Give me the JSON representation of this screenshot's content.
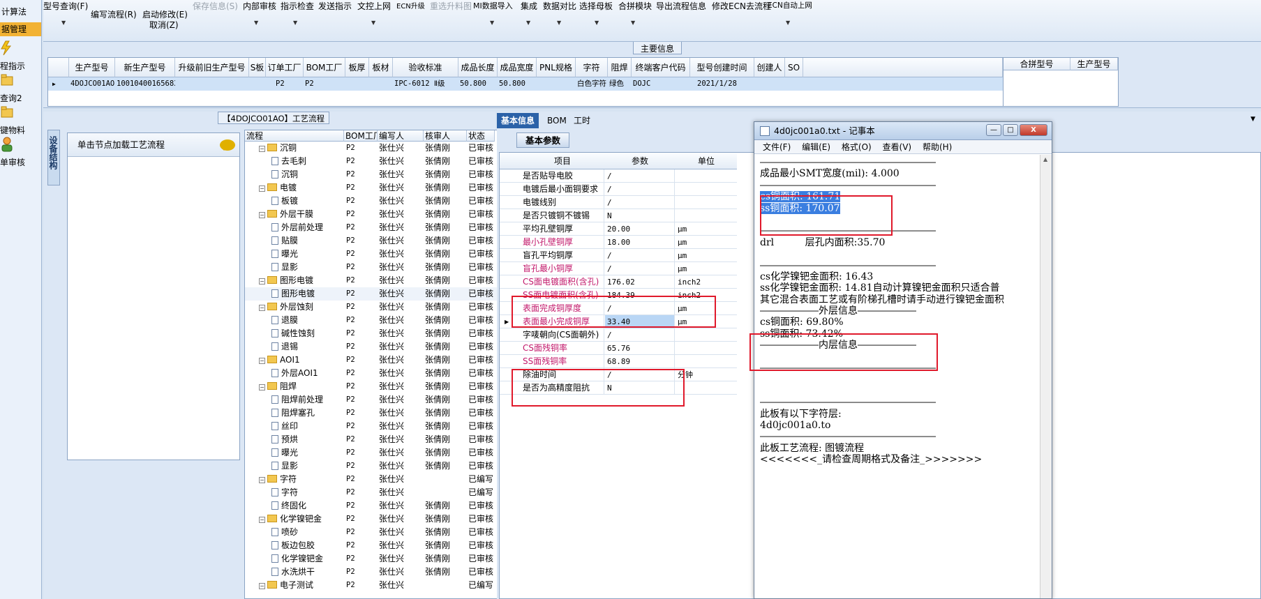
{
  "nav": {
    "items": [
      "计算法",
      "据管理",
      "程指示",
      "查询2",
      "键物料",
      "单审核"
    ]
  },
  "toolbar": {
    "row1": [
      "型号查询(F)",
      "保存信息(S)",
      "内部审核",
      "指示检查",
      "发送指示",
      "文控上网",
      "ECN升级",
      "重选升料图",
      "MI数据导入",
      "集成",
      "数据对比",
      "选择母板",
      "合拼模块",
      "导出流程信息",
      "修改ECN去流程",
      "ECN自动上网"
    ],
    "row2": [
      "编写流程(R)",
      "启动修改(E)"
    ],
    "row3": [
      "取消(Z)"
    ]
  },
  "main": {
    "title": "主要信息",
    "headers": [
      "生产型号",
      "新生产型号",
      "升级前旧生产型号",
      "S板",
      "订单工厂",
      "BOM工厂",
      "板厚",
      "板材",
      "验收标准",
      "成品长度",
      "成品宽度",
      "PNL规格",
      "字符",
      "阻焊",
      "终端客户代码",
      "型号创建时间",
      "创建人",
      "SO"
    ],
    "row": [
      "4DOJCO01AO",
      "10010400165683",
      "",
      "",
      "P2",
      "P2",
      "",
      "",
      "IPC-6012 Ⅱ级",
      "50.800",
      "50.800",
      "",
      "白色字符",
      "绿色",
      "DOJC",
      "2021/1/28",
      "",
      ""
    ],
    "right_headers": [
      "合拼型号",
      "生产型号"
    ]
  },
  "process": {
    "title": "【4DOJCO01AO】工艺流程",
    "side_tab": "设备结构",
    "load_text": "单击节点加载工艺流程",
    "headers": [
      "流程",
      "BOM工厂",
      "编写人",
      "核审人",
      "状态"
    ],
    "rows": [
      {
        "level": 1,
        "name": "沉铜",
        "factory": "P2",
        "writer": "张仕兴",
        "reviewer": "张倩刚",
        "status": "已审核"
      },
      {
        "level": 2,
        "name": "去毛刺",
        "factory": "P2",
        "writer": "张仕兴",
        "reviewer": "张倩刚",
        "status": "已审核"
      },
      {
        "level": 2,
        "name": "沉铜",
        "factory": "P2",
        "writer": "张仕兴",
        "reviewer": "张倩刚",
        "status": "已审核"
      },
      {
        "level": 1,
        "name": "电镀",
        "factory": "P2",
        "writer": "张仕兴",
        "reviewer": "张倩刚",
        "status": "已审核"
      },
      {
        "level": 2,
        "name": "板镀",
        "factory": "P2",
        "writer": "张仕兴",
        "reviewer": "张倩刚",
        "status": "已审核"
      },
      {
        "level": 1,
        "name": "外层干膜",
        "factory": "P2",
        "writer": "张仕兴",
        "reviewer": "张倩刚",
        "status": "已审核"
      },
      {
        "level": 2,
        "name": "外层前处理",
        "factory": "P2",
        "writer": "张仕兴",
        "reviewer": "张倩刚",
        "status": "已审核"
      },
      {
        "level": 2,
        "name": "贴膜",
        "factory": "P2",
        "writer": "张仕兴",
        "reviewer": "张倩刚",
        "status": "已审核"
      },
      {
        "level": 2,
        "name": "曝光",
        "factory": "P2",
        "writer": "张仕兴",
        "reviewer": "张倩刚",
        "status": "已审核"
      },
      {
        "level": 2,
        "name": "显影",
        "factory": "P2",
        "writer": "张仕兴",
        "reviewer": "张倩刚",
        "status": "已审核"
      },
      {
        "level": 1,
        "name": "图形电镀",
        "factory": "P2",
        "writer": "张仕兴",
        "reviewer": "张倩刚",
        "status": "已审核"
      },
      {
        "level": 2,
        "name": "图形电镀",
        "factory": "P2",
        "writer": "张仕兴",
        "reviewer": "张倩刚",
        "status": "已审核"
      },
      {
        "level": 1,
        "name": "外层蚀刻",
        "factory": "P2",
        "writer": "张仕兴",
        "reviewer": "张倩刚",
        "status": "已审核"
      },
      {
        "level": 2,
        "name": "退膜",
        "factory": "P2",
        "writer": "张仕兴",
        "reviewer": "张倩刚",
        "status": "已审核"
      },
      {
        "level": 2,
        "name": "碱性蚀刻",
        "factory": "P2",
        "writer": "张仕兴",
        "reviewer": "张倩刚",
        "status": "已审核"
      },
      {
        "level": 2,
        "name": "退锡",
        "factory": "P2",
        "writer": "张仕兴",
        "reviewer": "张倩刚",
        "status": "已审核"
      },
      {
        "level": 1,
        "name": "AOI1",
        "factory": "P2",
        "writer": "张仕兴",
        "reviewer": "张倩刚",
        "status": "已审核"
      },
      {
        "level": 2,
        "name": "外层AOI1",
        "factory": "P2",
        "writer": "张仕兴",
        "reviewer": "张倩刚",
        "status": "已审核"
      },
      {
        "level": 1,
        "name": "阻焊",
        "factory": "P2",
        "writer": "张仕兴",
        "reviewer": "张倩刚",
        "status": "已审核"
      },
      {
        "level": 2,
        "name": "阻焊前处理",
        "factory": "P2",
        "writer": "张仕兴",
        "reviewer": "张倩刚",
        "status": "已审核"
      },
      {
        "level": 2,
        "name": "阻焊塞孔",
        "factory": "P2",
        "writer": "张仕兴",
        "reviewer": "张倩刚",
        "status": "已审核"
      },
      {
        "level": 2,
        "name": "丝印",
        "factory": "P2",
        "writer": "张仕兴",
        "reviewer": "张倩刚",
        "status": "已审核"
      },
      {
        "level": 2,
        "name": "预烘",
        "factory": "P2",
        "writer": "张仕兴",
        "reviewer": "张倩刚",
        "status": "已审核"
      },
      {
        "level": 2,
        "name": "曝光",
        "factory": "P2",
        "writer": "张仕兴",
        "reviewer": "张倩刚",
        "status": "已审核"
      },
      {
        "level": 2,
        "name": "显影",
        "factory": "P2",
        "writer": "张仕兴",
        "reviewer": "张倩刚",
        "status": "已审核"
      },
      {
        "level": 1,
        "name": "字符",
        "factory": "P2",
        "writer": "张仕兴",
        "reviewer": "",
        "status": "已编写"
      },
      {
        "level": 2,
        "name": "字符",
        "factory": "P2",
        "writer": "张仕兴",
        "reviewer": "",
        "status": "已编写"
      },
      {
        "level": 2,
        "name": "终固化",
        "factory": "P2",
        "writer": "张仕兴",
        "reviewer": "张倩刚",
        "status": "已审核"
      },
      {
        "level": 1,
        "name": "化学镍钯金",
        "factory": "P2",
        "writer": "张仕兴",
        "reviewer": "张倩刚",
        "status": "已审核"
      },
      {
        "level": 2,
        "name": "喷砂",
        "factory": "P2",
        "writer": "张仕兴",
        "reviewer": "张倩刚",
        "status": "已审核"
      },
      {
        "level": 2,
        "name": "板边包胶",
        "factory": "P2",
        "writer": "张仕兴",
        "reviewer": "张倩刚",
        "status": "已审核"
      },
      {
        "level": 2,
        "name": "化学镍钯金",
        "factory": "P2",
        "writer": "张仕兴",
        "reviewer": "张倩刚",
        "status": "已审核"
      },
      {
        "level": 2,
        "name": "水洗烘干",
        "factory": "P2",
        "writer": "张仕兴",
        "reviewer": "张倩刚",
        "status": "已审核"
      },
      {
        "level": 1,
        "name": "电子测试",
        "factory": "P2",
        "writer": "张仕兴",
        "reviewer": "",
        "status": "已编写"
      }
    ]
  },
  "basic": {
    "tabs": [
      "基本信息",
      "BOM",
      "工时"
    ],
    "subtab": "基本参数",
    "headers": [
      "项目",
      "参数",
      "单位"
    ],
    "rows": [
      {
        "key": "是否贴导电胶",
        "val": "/",
        "unit": "",
        "red": false
      },
      {
        "key": "电镀后最小面铜要求",
        "val": "/",
        "unit": "",
        "red": false
      },
      {
        "key": "电镀线别",
        "val": "/",
        "unit": "",
        "red": false
      },
      {
        "key": "是否只镀铜不镀锡",
        "val": "N",
        "unit": "",
        "red": false
      },
      {
        "key": "平均孔壁铜厚",
        "val": "20.00",
        "unit": "μm",
        "red": false
      },
      {
        "key": "最小孔壁铜厚",
        "val": "18.00",
        "unit": "μm",
        "red": true
      },
      {
        "key": "盲孔平均铜厚",
        "val": "/",
        "unit": "μm",
        "red": false
      },
      {
        "key": "盲孔最小铜厚",
        "val": "/",
        "unit": "μm",
        "red": true
      },
      {
        "key": "CS面电镀面积(含孔)",
        "val": "176.02",
        "unit": "inch2",
        "red": true
      },
      {
        "key": "SS面电镀面积(含孔)",
        "val": "184.39",
        "unit": "inch2",
        "red": true
      },
      {
        "key": "表面完成铜厚度",
        "val": "/",
        "unit": "μm",
        "red": true
      },
      {
        "key": "表面最小完成铜厚",
        "val": "33.40",
        "unit": "μm",
        "red": true
      },
      {
        "key": "字唛朝向(CS面朝外)",
        "val": "/",
        "unit": "",
        "red": false
      },
      {
        "key": "CS面残铜率",
        "val": "65.76",
        "unit": "",
        "red": true
      },
      {
        "key": "SS面残铜率",
        "val": "68.89",
        "unit": "",
        "red": true
      },
      {
        "key": "除油时间",
        "val": "/",
        "unit": "分钟",
        "red": false
      },
      {
        "key": "是否为高精度阻抗",
        "val": "N",
        "unit": "",
        "red": false
      }
    ]
  },
  "notepad": {
    "title": "4d0jc001a0.txt - 记事本",
    "menu": [
      "文件(F)",
      "编辑(E)",
      "格式(O)",
      "查看(V)",
      "帮助(H)"
    ],
    "min_label": "—",
    "max_label": "□",
    "close_label": "X",
    "lines": [
      "――――――――――――――――――",
      "成品最小SMT宽度(mil): 4.000",
      "――――――――――――――――――",
      "cs铜面积: 161.71",
      "ss铜面积: 170.07",
      "",
      "――――――――――――――――――",
      "drl          层孔内面积:35.70",
      "",
      "――――――――――――――――――",
      "cs化学镍钯金面积: 16.43",
      "ss化学镍钯金面积: 14.81自动计算镍钯金面积只适合普",
      "其它混合表面工艺或有阶梯孔槽时请手动进行镍钯金面积",
      "――――――外层信息――――――",
      "cs铜面积: 69.80%",
      "ss铜面积: 73.42%",
      "――――――内层信息――――――",
      "",
      "――――――――――――――――――",
      "",
      "",
      "――――――――――――――――――",
      "此板有以下字符层:",
      "4d0jc001a0.to",
      "――――――――――――――――――",
      "此板工艺流程: 图镀流程",
      "<<<<<<<_请检查周期格式及备注_>>>>>>>"
    ]
  },
  "colors": {
    "accent": "#2b62a8",
    "highlight_box": "#e0192b",
    "red_text": "#c2186b",
    "selection": "#3a7ee0"
  }
}
